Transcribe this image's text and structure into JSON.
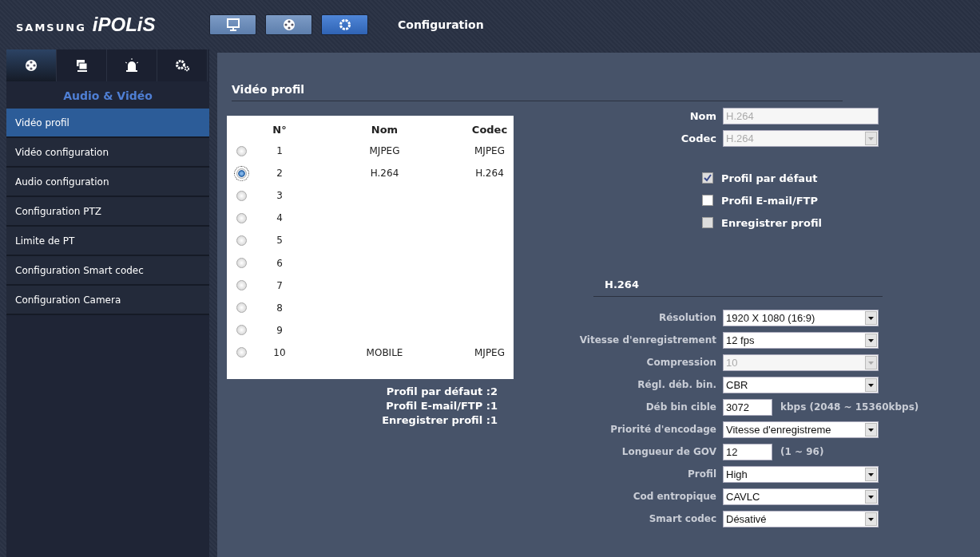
{
  "header": {
    "logo_brand": "SAMSUNG",
    "logo_product": "iPOLiS",
    "title": "Configuration",
    "mode_buttons": [
      {
        "kind": "monitor",
        "selected": false
      },
      {
        "kind": "film",
        "selected": false
      },
      {
        "kind": "gear",
        "selected": true
      }
    ]
  },
  "sidebar": {
    "tabs": [
      {
        "kind": "film",
        "selected": true
      },
      {
        "kind": "network",
        "selected": false
      },
      {
        "kind": "alarm",
        "selected": false
      },
      {
        "kind": "gears",
        "selected": false
      }
    ],
    "heading": "Audio & Vidéo",
    "items": [
      {
        "label": "Vidéo profil",
        "selected": true
      },
      {
        "label": "Vidéo configuration",
        "selected": false
      },
      {
        "label": "Audio configuration",
        "selected": false
      },
      {
        "label": "Configuration PTZ",
        "selected": false
      },
      {
        "label": "Limite de PT",
        "selected": false
      },
      {
        "label": "Configuration Smart codec",
        "selected": false
      },
      {
        "label": "Configuration Camera",
        "selected": false
      }
    ]
  },
  "profile_section": {
    "title": "Vidéo profil",
    "table": {
      "columns": [
        "N°",
        "Nom",
        "Codec"
      ],
      "rows": [
        {
          "number": "1",
          "name": "MJPEG",
          "codec": "MJPEG",
          "selected": false
        },
        {
          "number": "2",
          "name": "H.264",
          "codec": "H.264",
          "selected": true
        },
        {
          "number": "3",
          "selected": false
        },
        {
          "number": "4",
          "selected": false
        },
        {
          "number": "5",
          "selected": false
        },
        {
          "number": "6",
          "selected": false
        },
        {
          "number": "7",
          "selected": false
        },
        {
          "number": "8",
          "selected": false
        },
        {
          "number": "9",
          "selected": false
        },
        {
          "number": "10",
          "name": "MOBILE",
          "codec": "MJPEG",
          "selected": false
        }
      ]
    },
    "summary": [
      "Profil par défaut :2",
      "Profil E-mail/FTP :1",
      "Enregistrer profil :1"
    ]
  },
  "profile_form": {
    "fields": [
      {
        "kind": "text",
        "label": "Nom",
        "value": "H.264",
        "disabled": true
      },
      {
        "kind": "select",
        "label": "Codec",
        "value": "H.264",
        "disabled": true
      }
    ],
    "checkboxes": [
      {
        "label": "Profil par défaut",
        "checked": true,
        "disabled": true
      },
      {
        "label": "Profil E-mail/FTP",
        "checked": false,
        "disabled": false
      },
      {
        "label": "Enregistrer profil",
        "checked": false,
        "disabled": true
      }
    ]
  },
  "codec_section": {
    "title": "H.264",
    "fields": [
      {
        "kind": "select",
        "label": "Résolution",
        "value": "1920 X 1080 (16:9)",
        "disabled": false
      },
      {
        "kind": "select",
        "label": "Vitesse d'enregistrement",
        "value": "12 fps",
        "disabled": false
      },
      {
        "kind": "select",
        "label": "Compression",
        "value": "10",
        "disabled": true
      },
      {
        "kind": "select",
        "label": "Régl. déb. bin.",
        "value": "CBR",
        "disabled": false
      },
      {
        "kind": "short_text",
        "label": "Déb bin cible",
        "value": "3072",
        "suffix": "kbps (2048 ~ 15360kbps)",
        "disabled": false
      },
      {
        "kind": "select",
        "label": "Priorité d'encodage",
        "value": "Vitesse d'enregistreme",
        "disabled": false
      },
      {
        "kind": "short_text",
        "label": "Longueur de GOV",
        "value": "12",
        "suffix": "(1 ~ 96)",
        "disabled": false
      },
      {
        "kind": "select",
        "label": "Profil",
        "value": "High",
        "disabled": false
      },
      {
        "kind": "select",
        "label": "Cod entropique",
        "value": "CAVLC",
        "disabled": false
      },
      {
        "kind": "select",
        "label": "Smart codec",
        "value": "Désativé",
        "disabled": false
      }
    ]
  }
}
